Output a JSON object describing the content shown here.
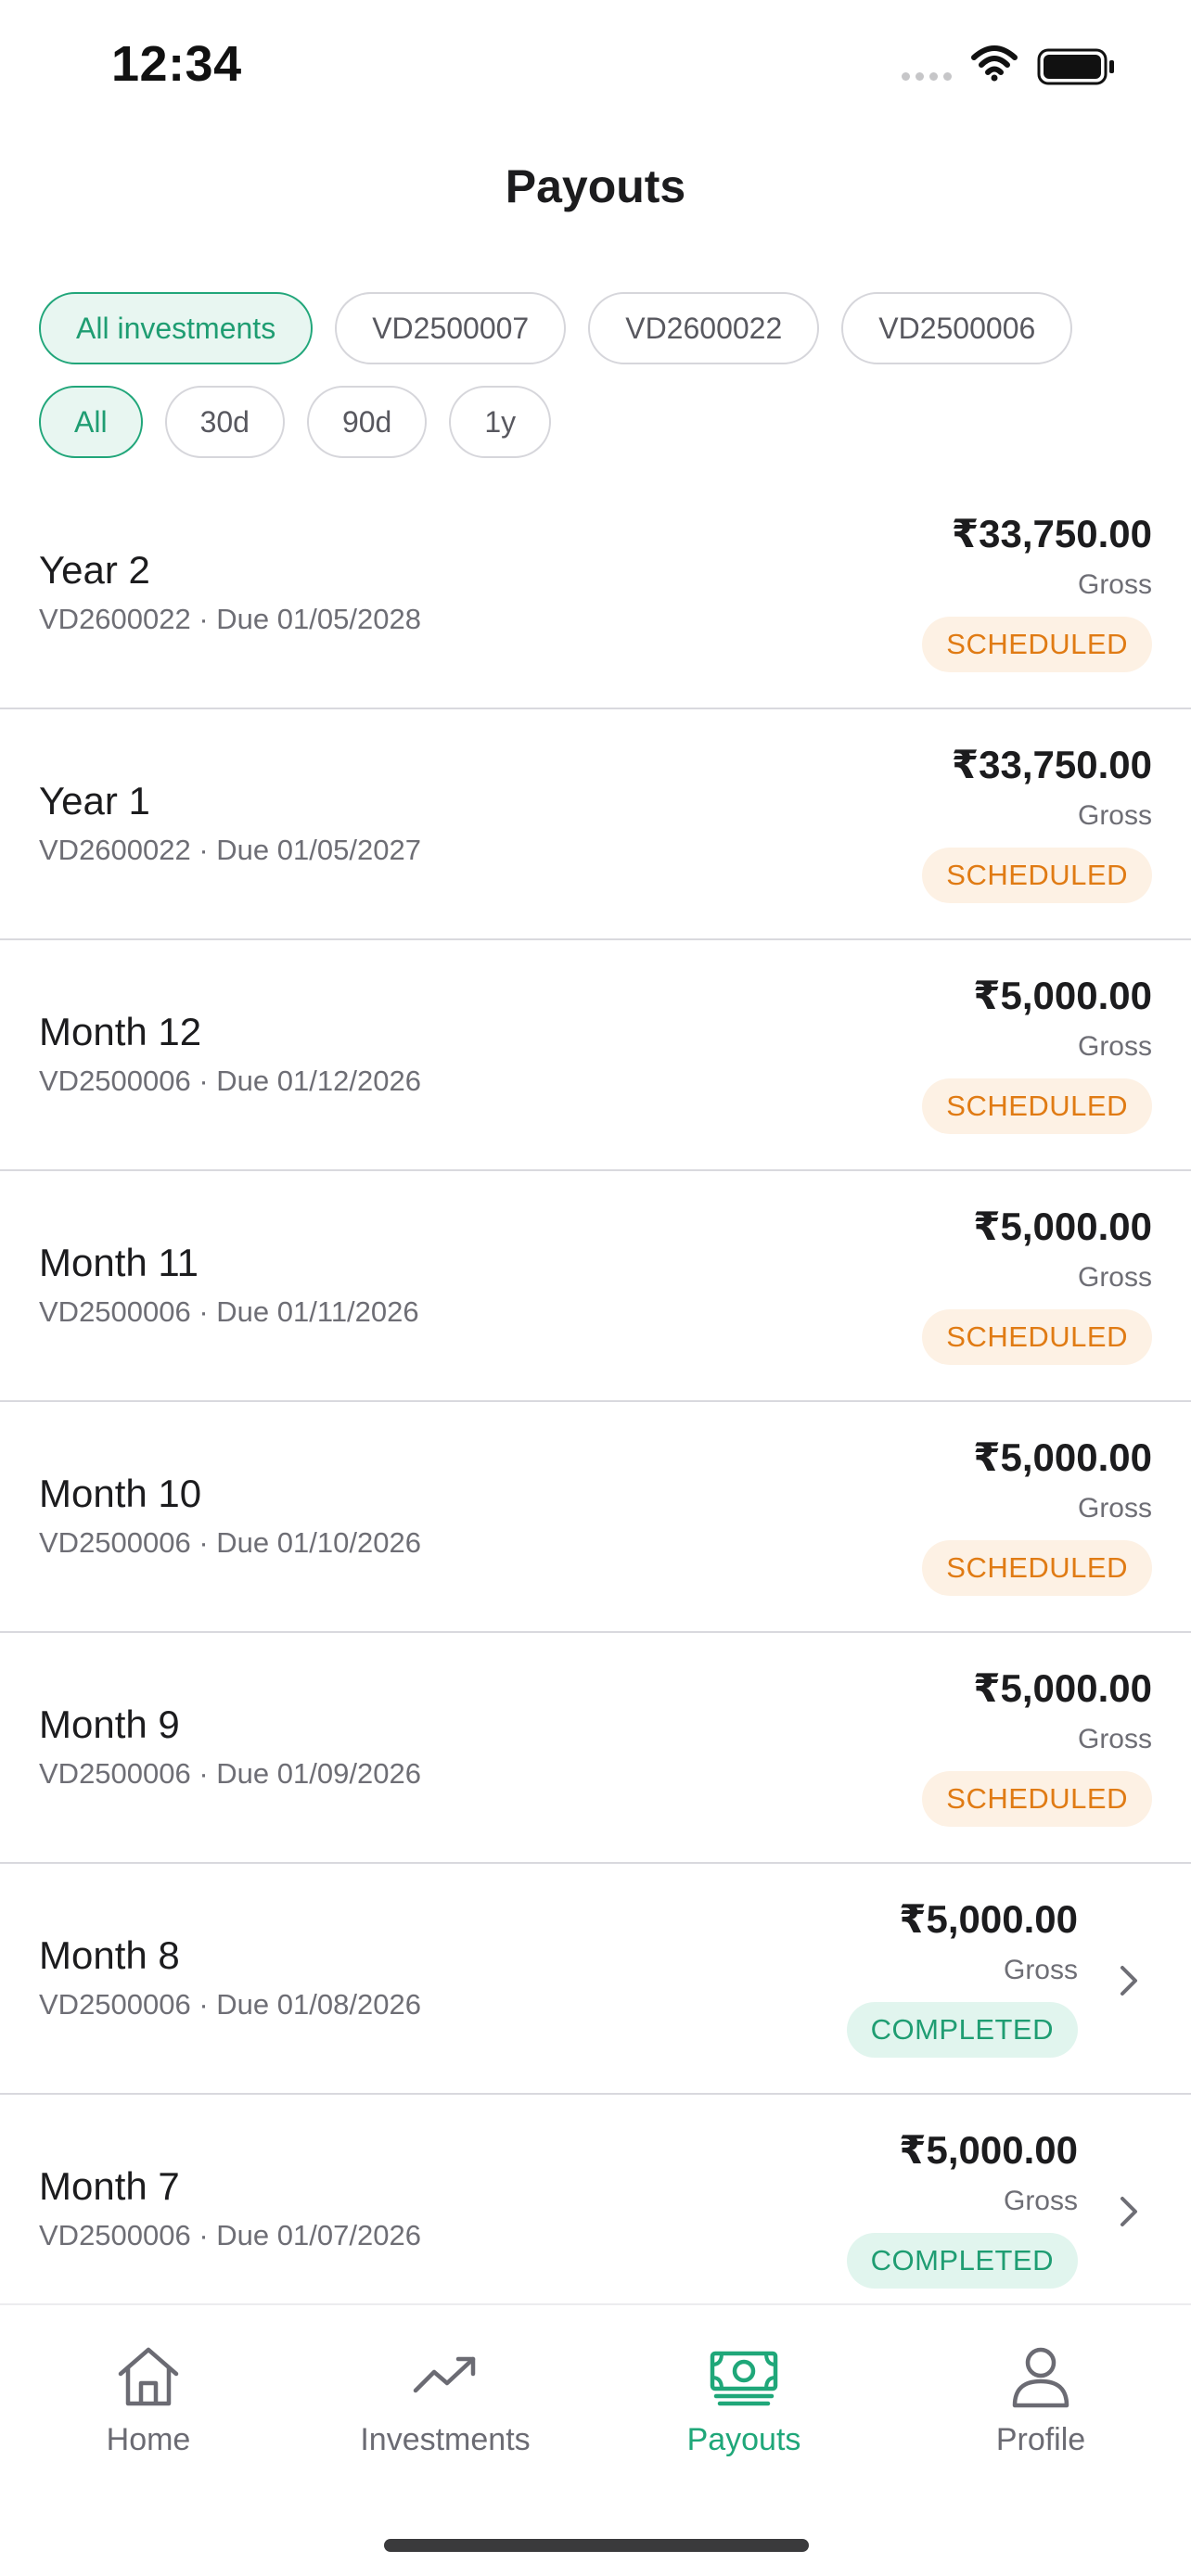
{
  "status_bar": {
    "time": "12:34"
  },
  "header": {
    "title": "Payouts"
  },
  "filters": {
    "investments": [
      {
        "label": "All investments",
        "active": true
      },
      {
        "label": "VD2500007",
        "active": false
      },
      {
        "label": "VD2600022",
        "active": false
      },
      {
        "label": "VD2500006",
        "active": false
      }
    ],
    "periods": [
      {
        "label": "All",
        "active": true
      },
      {
        "label": "30d",
        "active": false
      },
      {
        "label": "90d",
        "active": false
      },
      {
        "label": "1y",
        "active": false
      }
    ]
  },
  "payouts": [
    {
      "title": "Year 2",
      "subtitle": "VD2600022 · Due 01/05/2028",
      "amount": "₹33,750.00",
      "amount_type": "Gross",
      "status": "SCHEDULED"
    },
    {
      "title": "Year 1",
      "subtitle": "VD2600022 · Due 01/05/2027",
      "amount": "₹33,750.00",
      "amount_type": "Gross",
      "status": "SCHEDULED"
    },
    {
      "title": "Month 12",
      "subtitle": "VD2500006 · Due 01/12/2026",
      "amount": "₹5,000.00",
      "amount_type": "Gross",
      "status": "SCHEDULED"
    },
    {
      "title": "Month 11",
      "subtitle": "VD2500006 · Due 01/11/2026",
      "amount": "₹5,000.00",
      "amount_type": "Gross",
      "status": "SCHEDULED"
    },
    {
      "title": "Month 10",
      "subtitle": "VD2500006 · Due 01/10/2026",
      "amount": "₹5,000.00",
      "amount_type": "Gross",
      "status": "SCHEDULED"
    },
    {
      "title": "Month 9",
      "subtitle": "VD2500006 · Due 01/09/2026",
      "amount": "₹5,000.00",
      "amount_type": "Gross",
      "status": "SCHEDULED"
    },
    {
      "title": "Month 8",
      "subtitle": "VD2500006 · Due 01/08/2026",
      "amount": "₹5,000.00",
      "amount_type": "Gross",
      "status": "COMPLETED"
    },
    {
      "title": "Month 7",
      "subtitle": "VD2500006 · Due 01/07/2026",
      "amount": "₹5,000.00",
      "amount_type": "Gross",
      "status": "COMPLETED"
    }
  ],
  "tab_bar": {
    "items": [
      {
        "label": "Home",
        "icon": "home-icon",
        "active": false
      },
      {
        "label": "Investments",
        "icon": "trending-up-icon",
        "active": false
      },
      {
        "label": "Payouts",
        "icon": "cash-icon",
        "active": true
      },
      {
        "label": "Profile",
        "icon": "person-icon",
        "active": false
      }
    ]
  },
  "colors": {
    "accent": "#1fa779",
    "scheduled_text": "#e07b14",
    "scheduled_bg": "#fdf1e4",
    "completed_text": "#1f9d72",
    "completed_bg": "#e1f5ee"
  }
}
